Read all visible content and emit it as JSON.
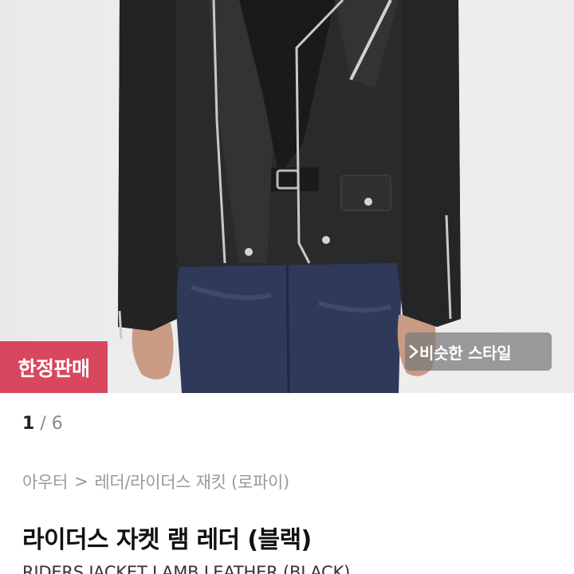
{
  "image": {
    "badge_label": "한정판매",
    "similar_style_label": "비슷한 스타일",
    "similar_style_icon": "chevron-right-icon"
  },
  "pager": {
    "current": "1",
    "separator": "/",
    "total": "6"
  },
  "breadcrumb": {
    "category": "아우터",
    "separator": ">",
    "subcategory": "레더/라이더스 재킷 (로파이)"
  },
  "product": {
    "title": "라이더스 자켓 램 레더 (블랙)",
    "subtitle": "RIDERS JACKET LAMB LEATHER (BLACK)"
  },
  "colors": {
    "badge": "#d9475e",
    "jacket": "#2a2a2c",
    "jeans": "#2e3a5c"
  }
}
